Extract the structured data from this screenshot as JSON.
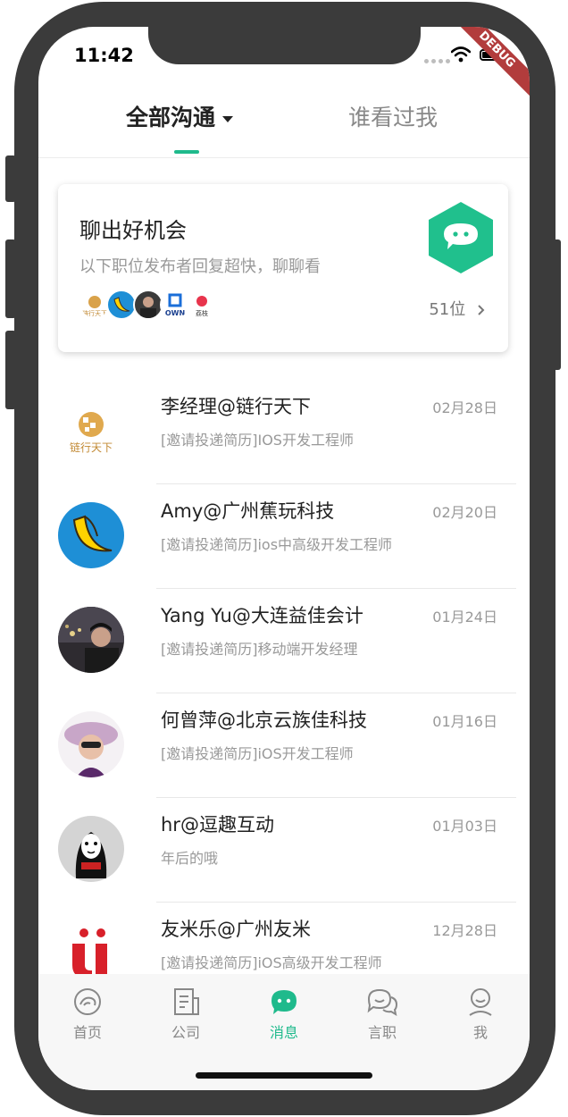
{
  "status": {
    "time": "11:42",
    "debug_label": "DEBUG"
  },
  "tabs": {
    "all_label": "全部沟通",
    "viewed_label": "谁看过我"
  },
  "promo": {
    "title": "聊出好机会",
    "subtitle": "以下职位发布者回复超快，聊聊看",
    "count": "51位"
  },
  "chats": [
    {
      "name": "李经理@链行天下",
      "date": "02月28日",
      "message": "[邀请投递简历]IOS开发工程师"
    },
    {
      "name": "Amy@广州蕉玩科技",
      "date": "02月20日",
      "message": "[邀请投递简历]ios中高级开发工程师"
    },
    {
      "name": "Yang Yu@大连益佳会计",
      "date": "01月24日",
      "message": "[邀请投递简历]移动端开发经理"
    },
    {
      "name": "何曾萍@北京云族佳科技",
      "date": "01月16日",
      "message": "[邀请投递简历]iOS开发工程师"
    },
    {
      "name": "hr@逗趣互动",
      "date": "01月03日",
      "message": "年后的哦"
    },
    {
      "name": "友米乐@广州友米",
      "date": "12月28日",
      "message": "[邀请投递简历]iOS高级开发工程师"
    }
  ],
  "logo_text": {
    "lianxing": "链行天下",
    "own": "OWN",
    "lizhi": "荔枝"
  },
  "tabbar": [
    {
      "label": "首页",
      "icon": "home-icon"
    },
    {
      "label": "公司",
      "icon": "company-icon"
    },
    {
      "label": "消息",
      "icon": "message-icon"
    },
    {
      "label": "言职",
      "icon": "discussion-icon"
    },
    {
      "label": "我",
      "icon": "profile-icon"
    }
  ],
  "colors": {
    "accent": "#1fba8c",
    "debug_banner": "#b23c3c",
    "frame": "#3b3b3b"
  }
}
